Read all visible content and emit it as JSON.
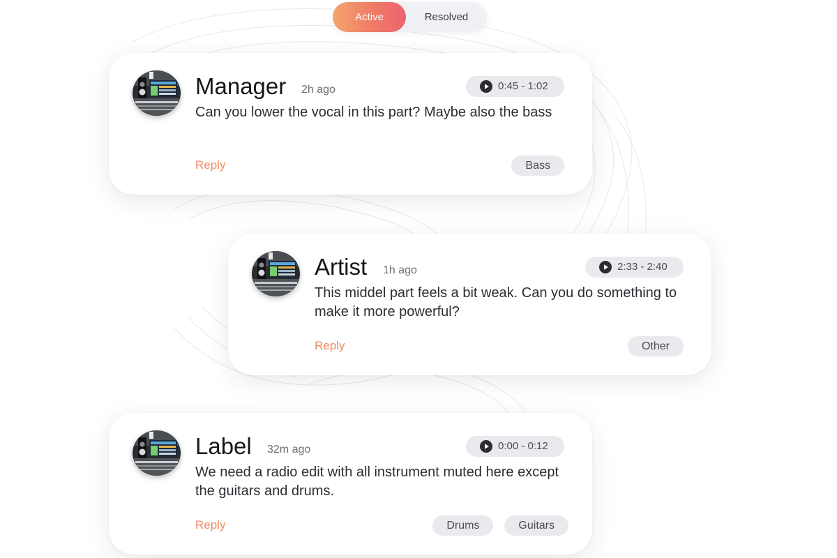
{
  "filter_toggle": {
    "options": [
      {
        "label": "Active",
        "selected": true
      },
      {
        "label": "Resolved",
        "selected": false
      }
    ]
  },
  "comments": [
    {
      "author": "Manager",
      "time": "2h ago",
      "timestamp": "0:45 - 1:02",
      "message": "Can you lower the vocal in this part? Maybe also the bass",
      "reply_label": "Reply",
      "tags": [
        "Bass"
      ]
    },
    {
      "author": "Artist",
      "time": "1h ago",
      "timestamp": "2:33 - 2:40",
      "message": "This middel part feels a bit weak. Can you do something to make it more powerful?",
      "reply_label": "Reply",
      "tags": [
        "Other"
      ]
    },
    {
      "author": "Label",
      "time": "32m ago",
      "timestamp": "0:00 - 0:12",
      "message": "We need a radio edit with all instrument muted here except the guitars and drums.",
      "reply_label": "Reply",
      "tags": [
        "Drums",
        "Guitars"
      ]
    }
  ],
  "colors": {
    "accent_start": "#f4a56e",
    "accent_end": "#ec6470",
    "reply": "#ef8a64",
    "chip_bg": "#e9eaee"
  },
  "icons": {
    "timestamp": "play-icon",
    "avatar": "studio-avatar-image"
  }
}
